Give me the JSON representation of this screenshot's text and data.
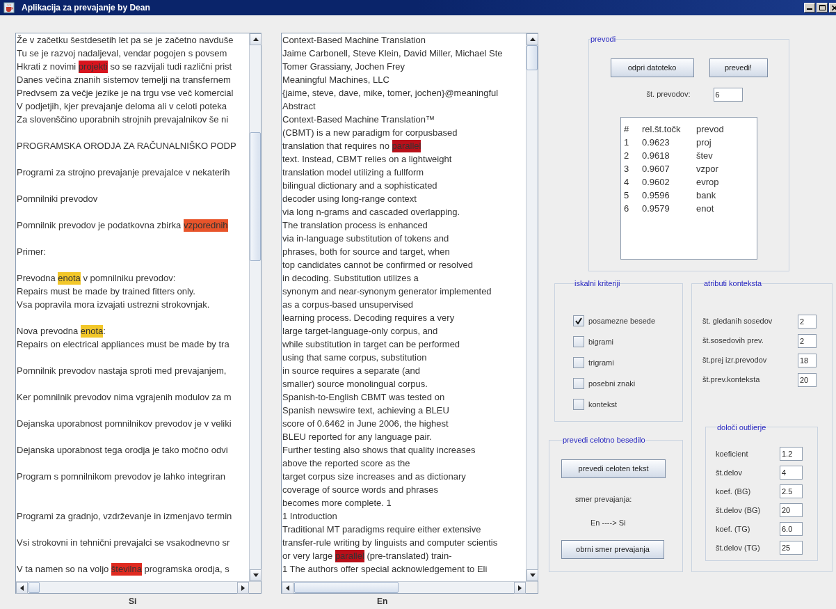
{
  "window": {
    "title": "Aplikacija za prevajanje by Dean"
  },
  "source_text": {
    "label": "Si",
    "lines": [
      {
        "kind": "text",
        "segments": [
          {
            "text": "Že v začetku šestdesetih let pa se je začetno navduše"
          }
        ]
      },
      {
        "kind": "text",
        "segments": [
          {
            "text": "Tu se je razvoj nadaljeval, vendar pogojen s povsem"
          }
        ]
      },
      {
        "kind": "text",
        "segments": [
          {
            "text": "Hkrati z novimi "
          },
          {
            "text": "projekti",
            "color": "#d8141e"
          },
          {
            "text": " so se razvijali tudi različni prist"
          }
        ]
      },
      {
        "kind": "text",
        "segments": [
          {
            "text": "Danes večina znanih sistemov temelji na transfernem"
          }
        ]
      },
      {
        "kind": "text",
        "segments": [
          {
            "text": "Predvsem za večje jezike je na trgu vse več komercial"
          }
        ]
      },
      {
        "kind": "text",
        "segments": [
          {
            "text": "V podjetjih, kjer prevajanje deloma ali v celoti poteka"
          }
        ]
      },
      {
        "kind": "text",
        "segments": [
          {
            "text": "Za slovenščino uporabnih strojnih prevajalnikov še ni"
          }
        ]
      },
      {
        "kind": "blank"
      },
      {
        "kind": "text",
        "segments": [
          {
            "text": "PROGRAMSKA ORODJA ZA RAČUNALNIŠKO PODP"
          }
        ]
      },
      {
        "kind": "blank"
      },
      {
        "kind": "text",
        "segments": [
          {
            "text": "Programi za strojno prevajanje prevajalce v nekaterih"
          }
        ]
      },
      {
        "kind": "blank"
      },
      {
        "kind": "text",
        "segments": [
          {
            "text": "Pomnilniki prevodov"
          }
        ]
      },
      {
        "kind": "blank"
      },
      {
        "kind": "text",
        "segments": [
          {
            "text": "Pomnilnik prevodov je podatkovna zbirka "
          },
          {
            "text": "vzporednih",
            "color": "#e8542a"
          }
        ]
      },
      {
        "kind": "blank"
      },
      {
        "kind": "text",
        "segments": [
          {
            "text": "Primer:"
          }
        ]
      },
      {
        "kind": "blank"
      },
      {
        "kind": "text",
        "segments": [
          {
            "text": "Prevodna "
          },
          {
            "text": "enota",
            "color": "#f2c72a"
          },
          {
            "text": " v pomnilniku prevodov:"
          }
        ]
      },
      {
        "kind": "text",
        "segments": [
          {
            "text": "Repairs must be made by trained fitters only."
          }
        ]
      },
      {
        "kind": "text",
        "segments": [
          {
            "text": "Vsa popravila mora izvajati ustrezni strokovnjak."
          }
        ]
      },
      {
        "kind": "blank"
      },
      {
        "kind": "text",
        "segments": [
          {
            "text": "Nova prevodna "
          },
          {
            "text": "enota",
            "color": "#f2c72a"
          },
          {
            "text": ":"
          }
        ]
      },
      {
        "kind": "text",
        "segments": [
          {
            "text": "Repairs on electrical appliances must be made by tra"
          }
        ]
      },
      {
        "kind": "blank"
      },
      {
        "kind": "text",
        "segments": [
          {
            "text": "Pomnilnik prevodov nastaja sproti med prevajanjem,"
          }
        ]
      },
      {
        "kind": "blank"
      },
      {
        "kind": "text",
        "segments": [
          {
            "text": "Ker pomnilnik prevodov nima vgrajenih modulov za m"
          }
        ]
      },
      {
        "kind": "blank"
      },
      {
        "kind": "text",
        "segments": [
          {
            "text": "Dejanska uporabnost pomnilnikov prevodov je v veliki"
          }
        ]
      },
      {
        "kind": "blank"
      },
      {
        "kind": "text",
        "segments": [
          {
            "text": "Dejanska uporabnost tega orodja je tako močno odvi"
          }
        ]
      },
      {
        "kind": "blank"
      },
      {
        "kind": "text",
        "segments": [
          {
            "text": "Program s pomnilnikom prevodov je lahko integriran"
          }
        ]
      },
      {
        "kind": "blank"
      },
      {
        "kind": "blank"
      },
      {
        "kind": "text",
        "segments": [
          {
            "text": "Programi za gradnjo, vzdrževanje in izmenjavo termin"
          }
        ]
      },
      {
        "kind": "blank"
      },
      {
        "kind": "text",
        "segments": [
          {
            "text": "Vsi strokovni in tehnični prevajalci se vsakodnevno sr"
          }
        ]
      },
      {
        "kind": "blank"
      },
      {
        "kind": "text",
        "segments": [
          {
            "text": "V ta namen so na voljo "
          },
          {
            "text": "številna",
            "color": "#e02a20"
          },
          {
            "text": " programska orodja, s"
          }
        ]
      }
    ]
  },
  "target_text": {
    "label": "En",
    "lines": [
      {
        "kind": "text",
        "segments": [
          {
            "text": "Context-Based Machine Translation"
          }
        ]
      },
      {
        "kind": "text",
        "segments": [
          {
            "text": "Jaime Carbonell, Steve Klein, David Miller, Michael Ste"
          }
        ]
      },
      {
        "kind": "text",
        "segments": [
          {
            "text": "Tomer Grassiany, Jochen Frey"
          }
        ]
      },
      {
        "kind": "text",
        "segments": [
          {
            "text": "Meaningful Machines, LLC"
          }
        ]
      },
      {
        "kind": "text",
        "segments": [
          {
            "text": "{jaime, steve, dave, mike, tomer, jochen}@meaningful"
          }
        ]
      },
      {
        "kind": "text",
        "segments": [
          {
            "text": "Abstract"
          }
        ]
      },
      {
        "kind": "text",
        "segments": [
          {
            "text": "Context-Based Machine Translation™"
          }
        ]
      },
      {
        "kind": "text",
        "segments": [
          {
            "text": "(CBMT) is a new paradigm for corpusbased"
          }
        ]
      },
      {
        "kind": "text",
        "segments": [
          {
            "text": "translation that requires no "
          },
          {
            "text": "parallel",
            "color": "#b8101a"
          }
        ]
      },
      {
        "kind": "text",
        "segments": [
          {
            "text": "text. Instead, CBMT relies on a lightweight"
          }
        ]
      },
      {
        "kind": "text",
        "segments": [
          {
            "text": "translation model utilizing a fullform"
          }
        ]
      },
      {
        "kind": "text",
        "segments": [
          {
            "text": "bilingual dictionary and a sophisticated"
          }
        ]
      },
      {
        "kind": "text",
        "segments": [
          {
            "text": "decoder using long-range context"
          }
        ]
      },
      {
        "kind": "text",
        "segments": [
          {
            "text": "via long n-grams and cascaded overlapping."
          }
        ]
      },
      {
        "kind": "text",
        "segments": [
          {
            "text": "The translation process is enhanced"
          }
        ]
      },
      {
        "kind": "text",
        "segments": [
          {
            "text": "via in-language substitution of tokens and"
          }
        ]
      },
      {
        "kind": "text",
        "segments": [
          {
            "text": "phrases, both for source and target, when"
          }
        ]
      },
      {
        "kind": "text",
        "segments": [
          {
            "text": "top candidates cannot be confirmed or resolved"
          }
        ]
      },
      {
        "kind": "text",
        "segments": [
          {
            "text": "in decoding. Substitution utilizes a"
          }
        ]
      },
      {
        "kind": "text",
        "segments": [
          {
            "text": "synonym and near-synonym generator implemented"
          }
        ]
      },
      {
        "kind": "text",
        "segments": [
          {
            "text": "as a corpus-based unsupervised"
          }
        ]
      },
      {
        "kind": "text",
        "segments": [
          {
            "text": "learning process. Decoding requires a very"
          }
        ]
      },
      {
        "kind": "text",
        "segments": [
          {
            "text": "large target-language-only corpus, and"
          }
        ]
      },
      {
        "kind": "text",
        "segments": [
          {
            "text": "while substitution in target can be performed"
          }
        ]
      },
      {
        "kind": "text",
        "segments": [
          {
            "text": "using that same corpus, substitution"
          }
        ]
      },
      {
        "kind": "text",
        "segments": [
          {
            "text": "in source requires a separate (and"
          }
        ]
      },
      {
        "kind": "text",
        "segments": [
          {
            "text": "smaller) source monolingual corpus."
          }
        ]
      },
      {
        "kind": "text",
        "segments": [
          {
            "text": "Spanish-to-English CBMT was tested on"
          }
        ]
      },
      {
        "kind": "text",
        "segments": [
          {
            "text": "Spanish newswire text, achieving a BLEU"
          }
        ]
      },
      {
        "kind": "text",
        "segments": [
          {
            "text": "score of 0.6462 in June 2006, the highest"
          }
        ]
      },
      {
        "kind": "text",
        "segments": [
          {
            "text": "BLEU reported for any language pair."
          }
        ]
      },
      {
        "kind": "text",
        "segments": [
          {
            "text": "Further testing also shows that quality increases"
          }
        ]
      },
      {
        "kind": "text",
        "segments": [
          {
            "text": "above the reported score as the"
          }
        ]
      },
      {
        "kind": "text",
        "segments": [
          {
            "text": "target corpus size increases and as dictionary"
          }
        ]
      },
      {
        "kind": "text",
        "segments": [
          {
            "text": "coverage of source words and phrases"
          }
        ]
      },
      {
        "kind": "text",
        "segments": [
          {
            "text": "becomes more complete. 1"
          }
        ]
      },
      {
        "kind": "text",
        "segments": [
          {
            "text": "1 Introduction"
          }
        ]
      },
      {
        "kind": "text",
        "segments": [
          {
            "text": "Traditional MT paradigms require either extensive"
          }
        ]
      },
      {
        "kind": "text",
        "segments": [
          {
            "text": "transfer-rule writing by linguists and computer scientis"
          }
        ]
      },
      {
        "kind": "text",
        "segments": [
          {
            "text": "or very large "
          },
          {
            "text": "parallel",
            "color": "#b8101a"
          },
          {
            "text": " (pre-translated) train-"
          }
        ]
      },
      {
        "kind": "text",
        "segments": [
          {
            "text": "1 The authors offer special acknowledgement to Eli"
          }
        ]
      }
    ]
  },
  "translations": {
    "title": "prevodi",
    "open_button": "odpri datoteko",
    "translate_button": "prevedi!",
    "count_label": "št. prevodov:",
    "count_value": "6",
    "results": {
      "columns": [
        "#",
        "rel.št.točk",
        "prevod"
      ],
      "rows": [
        [
          "1",
          "0.9623",
          "proj"
        ],
        [
          "2",
          "0.9618",
          "štev"
        ],
        [
          "3",
          "0.9607",
          "vzpor"
        ],
        [
          "4",
          "0.9602",
          "evrop"
        ],
        [
          "5",
          "0.9596",
          "bank"
        ],
        [
          "6",
          "0.9579",
          "enot"
        ]
      ]
    }
  },
  "search_criteria": {
    "title": "iskalni kriteriji",
    "options": [
      {
        "label": "posamezne besede",
        "checked": true
      },
      {
        "label": "bigrami",
        "checked": false
      },
      {
        "label": "trigrami",
        "checked": false
      },
      {
        "label": "posebni znaki",
        "checked": false
      },
      {
        "label": "kontekst",
        "checked": false
      }
    ]
  },
  "full_translation": {
    "title": "prevedi celotno besedilo",
    "translate_button": "prevedi celoten tekst",
    "direction_label": "smer prevajanja:",
    "direction": "En ----> Si",
    "reverse_button": "obrni smer prevajanja"
  },
  "context_attributes": {
    "title": "atributi konteksta",
    "fields": [
      {
        "label": "št. gledanih sosedov",
        "value": "2"
      },
      {
        "label": "št.sosedovih prev.",
        "value": "2"
      },
      {
        "label": "št.prej izr.prevodov",
        "value": "18"
      },
      {
        "label": "št.prev.konteksta",
        "value": "20"
      }
    ],
    "outliers": {
      "title": "določi outlierje",
      "fields": [
        {
          "label": "koeficient",
          "value": "1.2"
        },
        {
          "label": "št.delov",
          "value": "4"
        },
        {
          "label": "koef. (BG)",
          "value": "2.5"
        },
        {
          "label": "št.delov (BG)",
          "value": "20"
        },
        {
          "label": "koef. (TG)",
          "value": "6.0"
        },
        {
          "label": "št.delov (TG)",
          "value": "25"
        }
      ]
    }
  }
}
